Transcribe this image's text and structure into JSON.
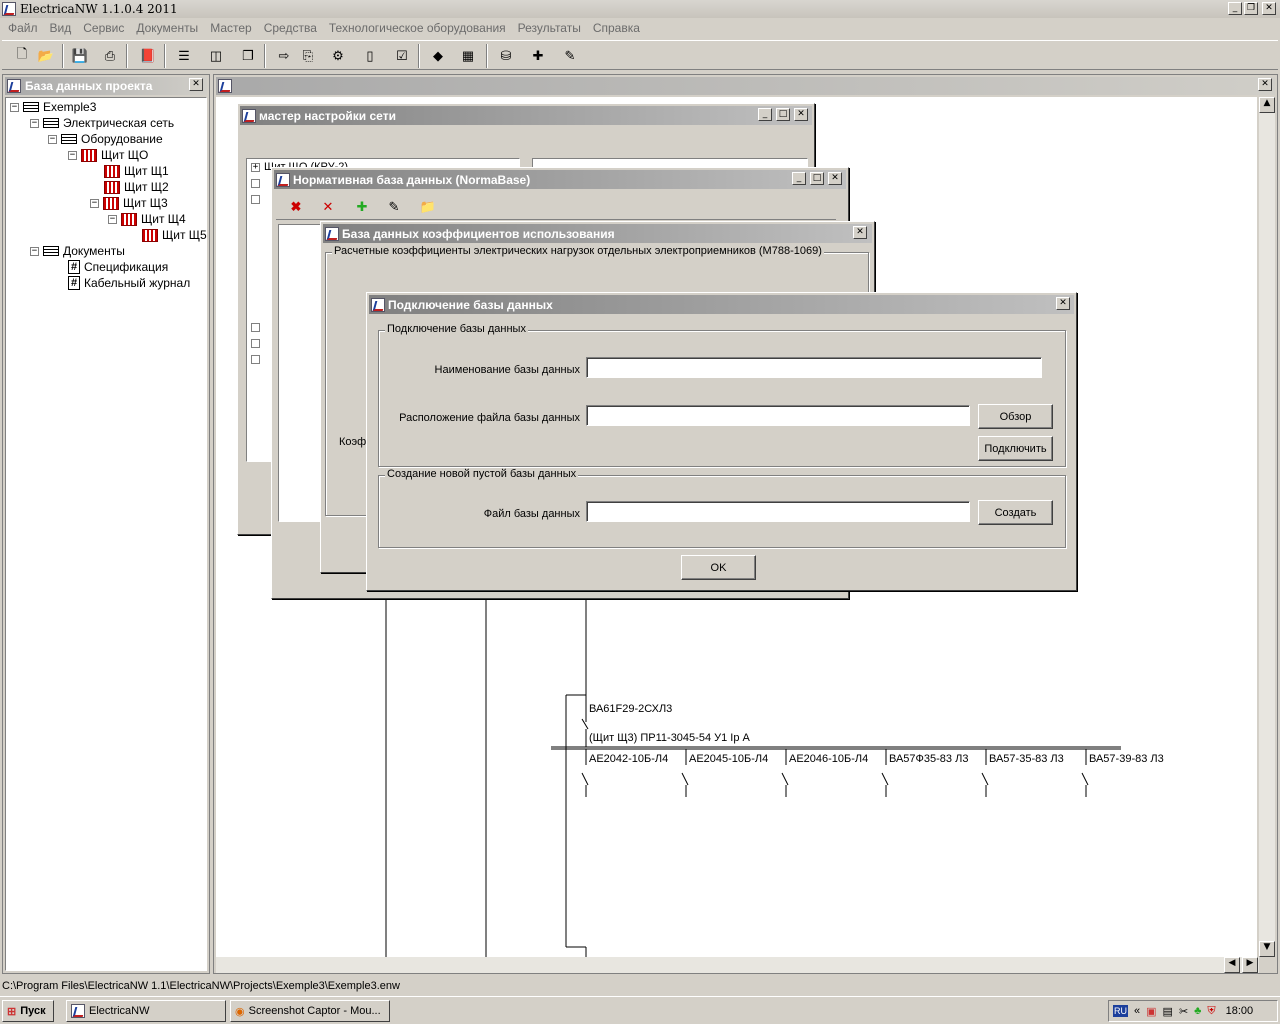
{
  "app": {
    "title": "ElectricaNW 1.1.0.4 2011"
  },
  "menu": [
    "Файл",
    "Вид",
    "Сервис",
    "Документы",
    "Мастер",
    "Средства",
    "Технологическое оборудования",
    "Результаты",
    "Справка"
  ],
  "project_panel": {
    "title": "База данных проекта",
    "tree": [
      {
        "label": "Exemple3",
        "icon": "database-icon"
      },
      {
        "label": "Электрическая сеть",
        "icon": "database-icon"
      },
      {
        "label": "Оборудование",
        "icon": "database-icon"
      },
      {
        "label": "Щит ЩО",
        "icon": "switchboard-icon"
      },
      {
        "label": "Щит Щ1",
        "icon": "switchboard-icon"
      },
      {
        "label": "Щит Щ2",
        "icon": "switchboard-icon"
      },
      {
        "label": "Щит Щ3",
        "icon": "switchboard-icon"
      },
      {
        "label": "Щит Щ4",
        "icon": "switchboard-icon"
      },
      {
        "label": "Щит Щ5",
        "icon": "switchboard-icon"
      },
      {
        "label": "Документы",
        "icon": "database-icon"
      },
      {
        "label": "Спецификация",
        "icon": "document-icon"
      },
      {
        "label": "Кабельный журнал",
        "icon": "document-icon"
      }
    ]
  },
  "dialogs": {
    "network_wizard": {
      "title": "мастер настройки сети",
      "tree_top": "Щит ЩО (КРУ-2)"
    },
    "normabase": {
      "title": "Нормативная база данных (NormaBase)"
    },
    "coeff_db": {
      "title": "База данных коэффициентов использования",
      "group": "Расчетные коэффициенты электрических нагрузок отдельных электроприемников (М788-1069)",
      "side_label": "Коэф"
    },
    "connect_db": {
      "title": "Подключение базы данных",
      "group1": "Подключение базы данных",
      "name_label": "Наименование базы данных",
      "name_value": "",
      "location_label": "Расположение файла базы данных",
      "location_value": "",
      "browse": "Обзор",
      "connect": "Подключить",
      "group2": "Создание новой пустой базы данных",
      "file_label": "Файл базы данных",
      "file_value": "",
      "create": "Создать",
      "ok": "OK"
    }
  },
  "schematic": {
    "main_breaker": "ВА61F29-2СХЛ3",
    "bus_label": "(Щит Щ3)  ПР11-3045-54 У1 Iр  А",
    "feeders": [
      "АЕ2042-10Б-Л4",
      "АЕ2045-10Б-Л4",
      "АЕ2046-10Б-Л4",
      "ВА57Ф35-83 Л3",
      "ВА57-35-83 Л3",
      "ВА57-39-83 Л3"
    ]
  },
  "status": {
    "path": "C:\\Program Files\\ElectricaNW 1.1\\ElectricaNW\\Projects\\Exemple3\\Exemple3.enw"
  },
  "taskbar": {
    "start": "Пуск",
    "tasks": [
      "ElectricaNW",
      "Screenshot Captor - Mou..."
    ],
    "lang": "RU",
    "time": "18:00"
  }
}
